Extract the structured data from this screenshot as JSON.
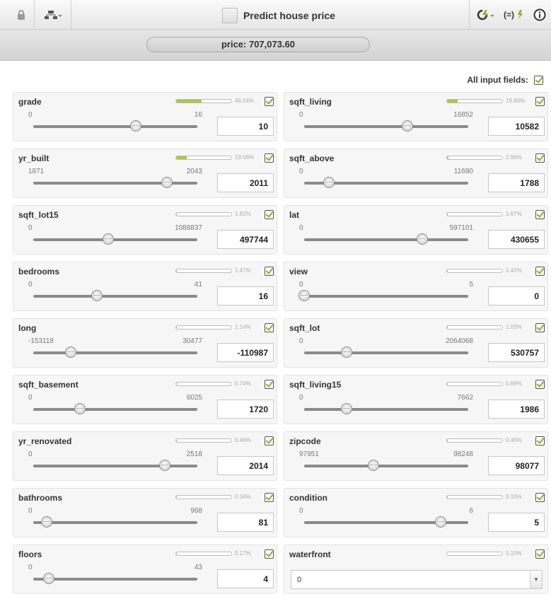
{
  "window": {
    "title": "Predict house price"
  },
  "prediction": {
    "label": "price: 707,073.60"
  },
  "all_input_fields_label": "All input fields:",
  "toolbar": {
    "lock_icon": "lock-icon",
    "tree_icon": "tree-icon",
    "batch_icon": "lightning-icon",
    "formula_icon": "formula-icon",
    "info_icon": "info-icon"
  },
  "colors": {
    "importance_bar": "#a7c94a",
    "check": "#7fb62e"
  },
  "fields": [
    {
      "name": "grade",
      "importance_pct": "46.54%",
      "importance": 0.4654,
      "min": "0",
      "max": "16",
      "value": "10",
      "slider": 0.625
    },
    {
      "name": "sqft_living",
      "importance_pct": "19.80%",
      "importance": 0.198,
      "min": "0",
      "max": "16852",
      "value": "10582",
      "slider": 0.628
    },
    {
      "name": "yr_built",
      "importance_pct": "19.06%",
      "importance": 0.1906,
      "min": "1871",
      "max": "2043",
      "value": "2011",
      "slider": 0.814
    },
    {
      "name": "sqft_above",
      "importance_pct": "2.96%",
      "importance": 0.0296,
      "min": "0",
      "max": "11690",
      "value": "1788",
      "slider": 0.153
    },
    {
      "name": "sqft_lot15",
      "importance_pct": "1.82%",
      "importance": 0.0182,
      "min": "0",
      "max": "1088837",
      "value": "497744",
      "slider": 0.457
    },
    {
      "name": "lat",
      "importance_pct": "1.67%",
      "importance": 0.0167,
      "min": "0",
      "max": "597101",
      "value": "430655",
      "slider": 0.721
    },
    {
      "name": "bedrooms",
      "importance_pct": "1.47%",
      "importance": 0.0147,
      "min": "0",
      "max": "41",
      "value": "16",
      "slider": 0.39
    },
    {
      "name": "view",
      "importance_pct": "1.42%",
      "importance": 0.0142,
      "min": "0",
      "max": "5",
      "value": "0",
      "slider": 0.0
    },
    {
      "name": "long",
      "importance_pct": "1.14%",
      "importance": 0.0114,
      "min": "-153118",
      "max": "30477",
      "value": "-110987",
      "slider": 0.229
    },
    {
      "name": "sqft_lot",
      "importance_pct": "1.03%",
      "importance": 0.0103,
      "min": "0",
      "max": "2064068",
      "value": "530757",
      "slider": 0.257
    },
    {
      "name": "sqft_basement",
      "importance_pct": "0.74%",
      "importance": 0.0074,
      "min": "0",
      "max": "6025",
      "value": "1720",
      "slider": 0.285
    },
    {
      "name": "sqft_living15",
      "importance_pct": "0.69%",
      "importance": 0.0069,
      "min": "0",
      "max": "7662",
      "value": "1986",
      "slider": 0.259
    },
    {
      "name": "yr_renovated",
      "importance_pct": "0.46%",
      "importance": 0.0046,
      "min": "0",
      "max": "2518",
      "value": "2014",
      "slider": 0.8
    },
    {
      "name": "zipcode",
      "importance_pct": "0.45%",
      "importance": 0.0045,
      "min": "97951",
      "max": "98248",
      "value": "98077",
      "slider": 0.424
    },
    {
      "name": "bathrooms",
      "importance_pct": "0.34%",
      "importance": 0.0034,
      "min": "0",
      "max": "968",
      "value": "81",
      "slider": 0.084
    },
    {
      "name": "condition",
      "importance_pct": "0.33%",
      "importance": 0.0033,
      "min": "0",
      "max": "6",
      "value": "5",
      "slider": 0.833
    },
    {
      "name": "floors",
      "importance_pct": "0.17%",
      "importance": 0.0017,
      "min": "0",
      "max": "43",
      "value": "4",
      "slider": 0.093
    },
    {
      "name": "waterfront",
      "importance_pct": "0.10%",
      "importance": 0.001,
      "type": "select",
      "value": "0"
    }
  ]
}
